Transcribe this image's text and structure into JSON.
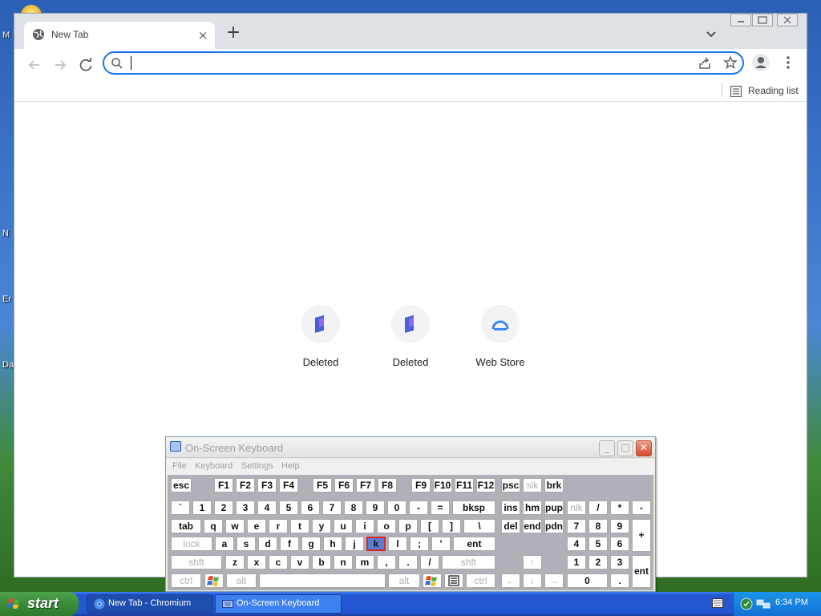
{
  "desktop": {
    "icon_fragments": [
      "M",
      "N",
      "Er",
      "Da"
    ]
  },
  "browser": {
    "tab": {
      "title": "New Tab",
      "close": "×"
    },
    "new_tab": "+",
    "omnibox": {
      "value": "",
      "placeholder": ""
    },
    "bookmarks": {
      "reading_list": "Reading list"
    },
    "tiles": [
      {
        "label": "Deleted",
        "icon": "bookmark-tile-icon"
      },
      {
        "label": "Deleted",
        "icon": "bookmark-tile-icon"
      },
      {
        "label": "Web Store",
        "icon": "webstore-icon"
      }
    ],
    "colors": {
      "accent": "#1a73e8",
      "tabstrip": "#dee1e6"
    }
  },
  "osk": {
    "title": "On-Screen Keyboard",
    "controls": {
      "minimize": "_",
      "maximize": "□",
      "close": "✕"
    },
    "menu": [
      "File",
      "Keyboard",
      "Settings",
      "Help"
    ],
    "highlighted_key": "k",
    "rows": [
      [
        "esc",
        "F1",
        "F2",
        "F3",
        "F4",
        "F5",
        "F6",
        "F7",
        "F8",
        "F9",
        "F10",
        "F11",
        "F12",
        "psc",
        "slk",
        "brk"
      ],
      [
        "`",
        "1",
        "2",
        "3",
        "4",
        "5",
        "6",
        "7",
        "8",
        "9",
        "0",
        "-",
        "=",
        "bksp",
        "ins",
        "hm",
        "pup",
        "nlk",
        "/",
        "*",
        "-"
      ],
      [
        "tab",
        "q",
        "w",
        "e",
        "r",
        "t",
        "y",
        "u",
        "i",
        "o",
        "p",
        "[",
        "]",
        "\\",
        "del",
        "end",
        "pdn",
        "7",
        "8",
        "9",
        "+"
      ],
      [
        "lock",
        "a",
        "s",
        "d",
        "f",
        "g",
        "h",
        "j",
        "k",
        "l",
        ";",
        "'",
        "ent",
        "4",
        "5",
        "6"
      ],
      [
        "shft",
        "z",
        "x",
        "c",
        "v",
        "b",
        "n",
        "m",
        ",",
        ".",
        "/",
        "shft",
        "↑",
        "1",
        "2",
        "3",
        "ent"
      ],
      [
        "ctrl",
        "alt",
        "alt",
        "ctrl",
        "←",
        "↓",
        "→",
        "0",
        "."
      ]
    ]
  },
  "taskbar": {
    "start": "start",
    "tasks": [
      {
        "label": "New Tab - Chromium",
        "active": true
      },
      {
        "label": "On-Screen Keyboard",
        "active": false
      }
    ],
    "clock": "6:34 PM"
  }
}
